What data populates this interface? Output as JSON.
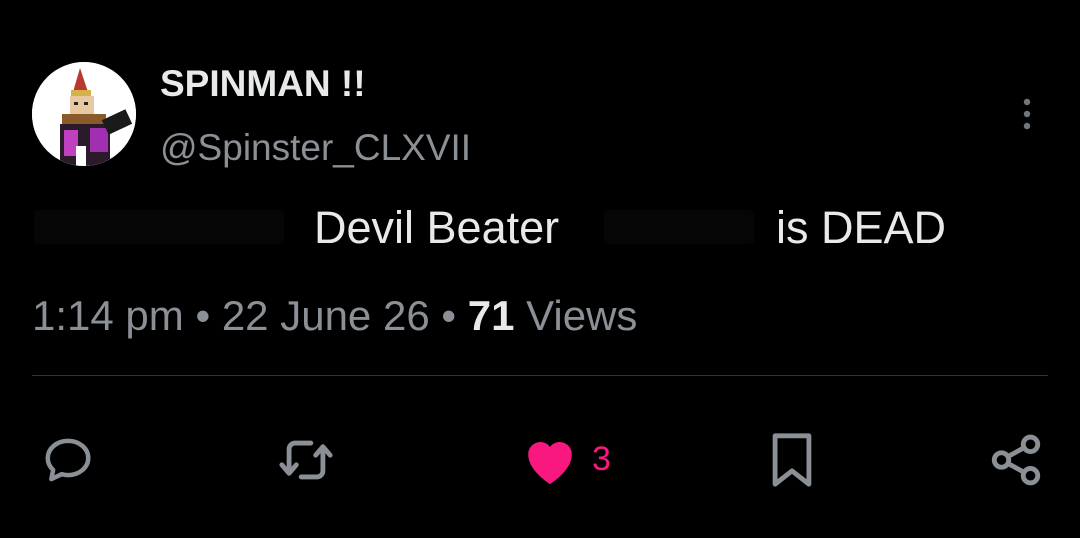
{
  "author": {
    "display_name": "SPINMAN !!",
    "handle": "@Spinster_CLXVII",
    "avatar_icon": "roblox-character-avatar"
  },
  "post": {
    "text_segment_1": "Devil Beater",
    "text_segment_2": "is DEAD"
  },
  "meta": {
    "time": "1:14 pm",
    "separator": "•",
    "date": "22 June 26",
    "views_count": "71",
    "views_label": "Views"
  },
  "actions": {
    "reply_icon": "speech-bubble-icon",
    "repost_icon": "repost-icon",
    "like_icon": "heart-icon",
    "like_count": "3",
    "bookmark_icon": "bookmark-icon",
    "share_icon": "share-icon"
  },
  "colors": {
    "background": "#000000",
    "primary_text": "#e7e9ea",
    "secondary_text": "#8b9096",
    "like_pink": "#f91880",
    "divider": "#2f3336"
  }
}
